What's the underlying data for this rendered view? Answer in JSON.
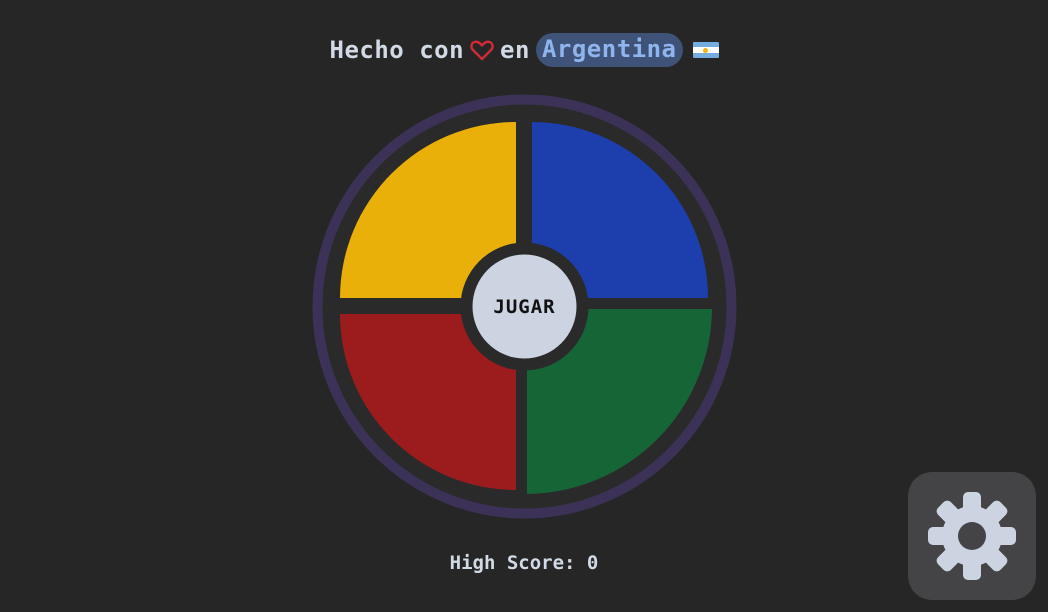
{
  "header": {
    "text_before": "Hecho con",
    "heart_icon": "heart-outline-icon",
    "text_middle": "en",
    "country": "Argentina",
    "flag_icon": "argentina-flag-icon"
  },
  "game": {
    "play_label": "JUGAR",
    "quadrants": [
      {
        "name": "yellow",
        "color": "#e8b008"
      },
      {
        "name": "blue",
        "color": "#1d3fae"
      },
      {
        "name": "red",
        "color": "#9c1b1d"
      },
      {
        "name": "green",
        "color": "#166537"
      }
    ],
    "ring_color": "#3c3257",
    "center_color": "#cbd4e0"
  },
  "score": {
    "label": "High Score: 0"
  },
  "settings": {
    "icon": "gear-icon"
  },
  "colors": {
    "background": "#262626",
    "text": "#d2dae6",
    "heart": "#d22a36",
    "pill_bg": "#3f5378",
    "pill_text": "#8fb4ee",
    "settings_bg": "#444446"
  }
}
